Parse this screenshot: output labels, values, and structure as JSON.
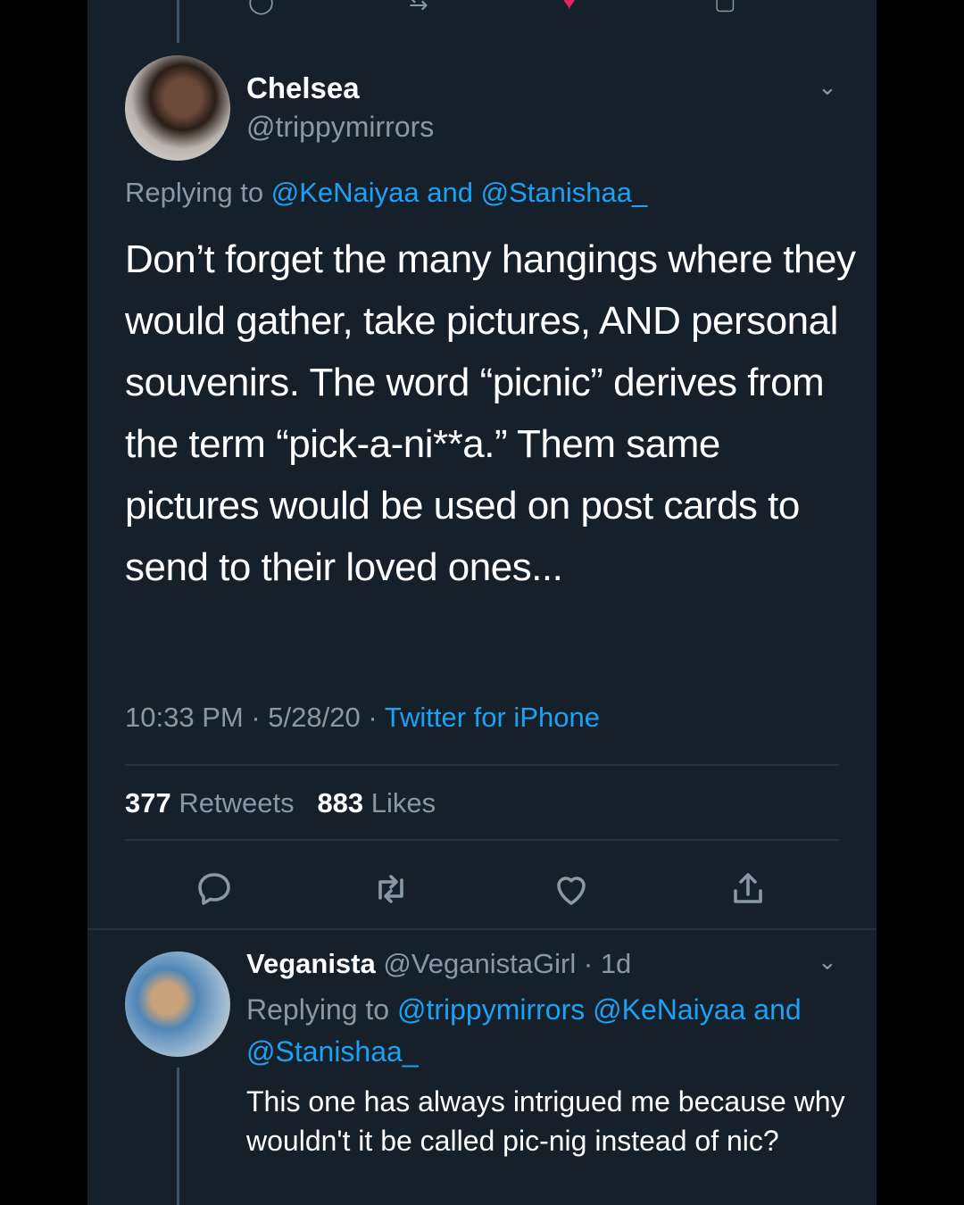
{
  "tweet": {
    "author_name": "Chelsea",
    "author_handle": "@trippymirrors",
    "replying_prefix": "Replying to",
    "replying_user1": "@KeNaiyaa",
    "replying_and": "and",
    "replying_user2": "@Stanishaa_",
    "text": "Don’t forget the many hangings where they would gather, take pictures, AND personal souvenirs. The word “picnic” derives from the term “pick-a-ni**a.” Them same pictures would be used on post cards to send to their loved ones...",
    "time": "10:33 PM",
    "date": "5/28/20",
    "sep": "·",
    "source": "Twitter for iPhone",
    "retweets_count": "377",
    "retweets_label": "Retweets",
    "likes_count": "883",
    "likes_label": "Likes"
  },
  "reply": {
    "author_name": "Veganista",
    "author_handle": "@VeganistaGirl",
    "sep": "·",
    "age": "1d",
    "replying_prefix": "Replying to",
    "replying_user1": "@trippymirrors",
    "replying_user2": "@KeNaiyaa",
    "replying_and": "and",
    "replying_user3": "@Stanishaa_",
    "text": "This one has always intrigued me because why wouldn't it be called pic-nig instead of nic?"
  },
  "icons": {
    "chevron": "chevron-down-icon",
    "reply": "reply-icon",
    "retweet": "retweet-icon",
    "like": "heart-icon",
    "share": "share-icon"
  },
  "colors": {
    "background": "#15202b",
    "accent": "#1da1f2",
    "muted": "#8899a6",
    "like": "#e0245e"
  }
}
